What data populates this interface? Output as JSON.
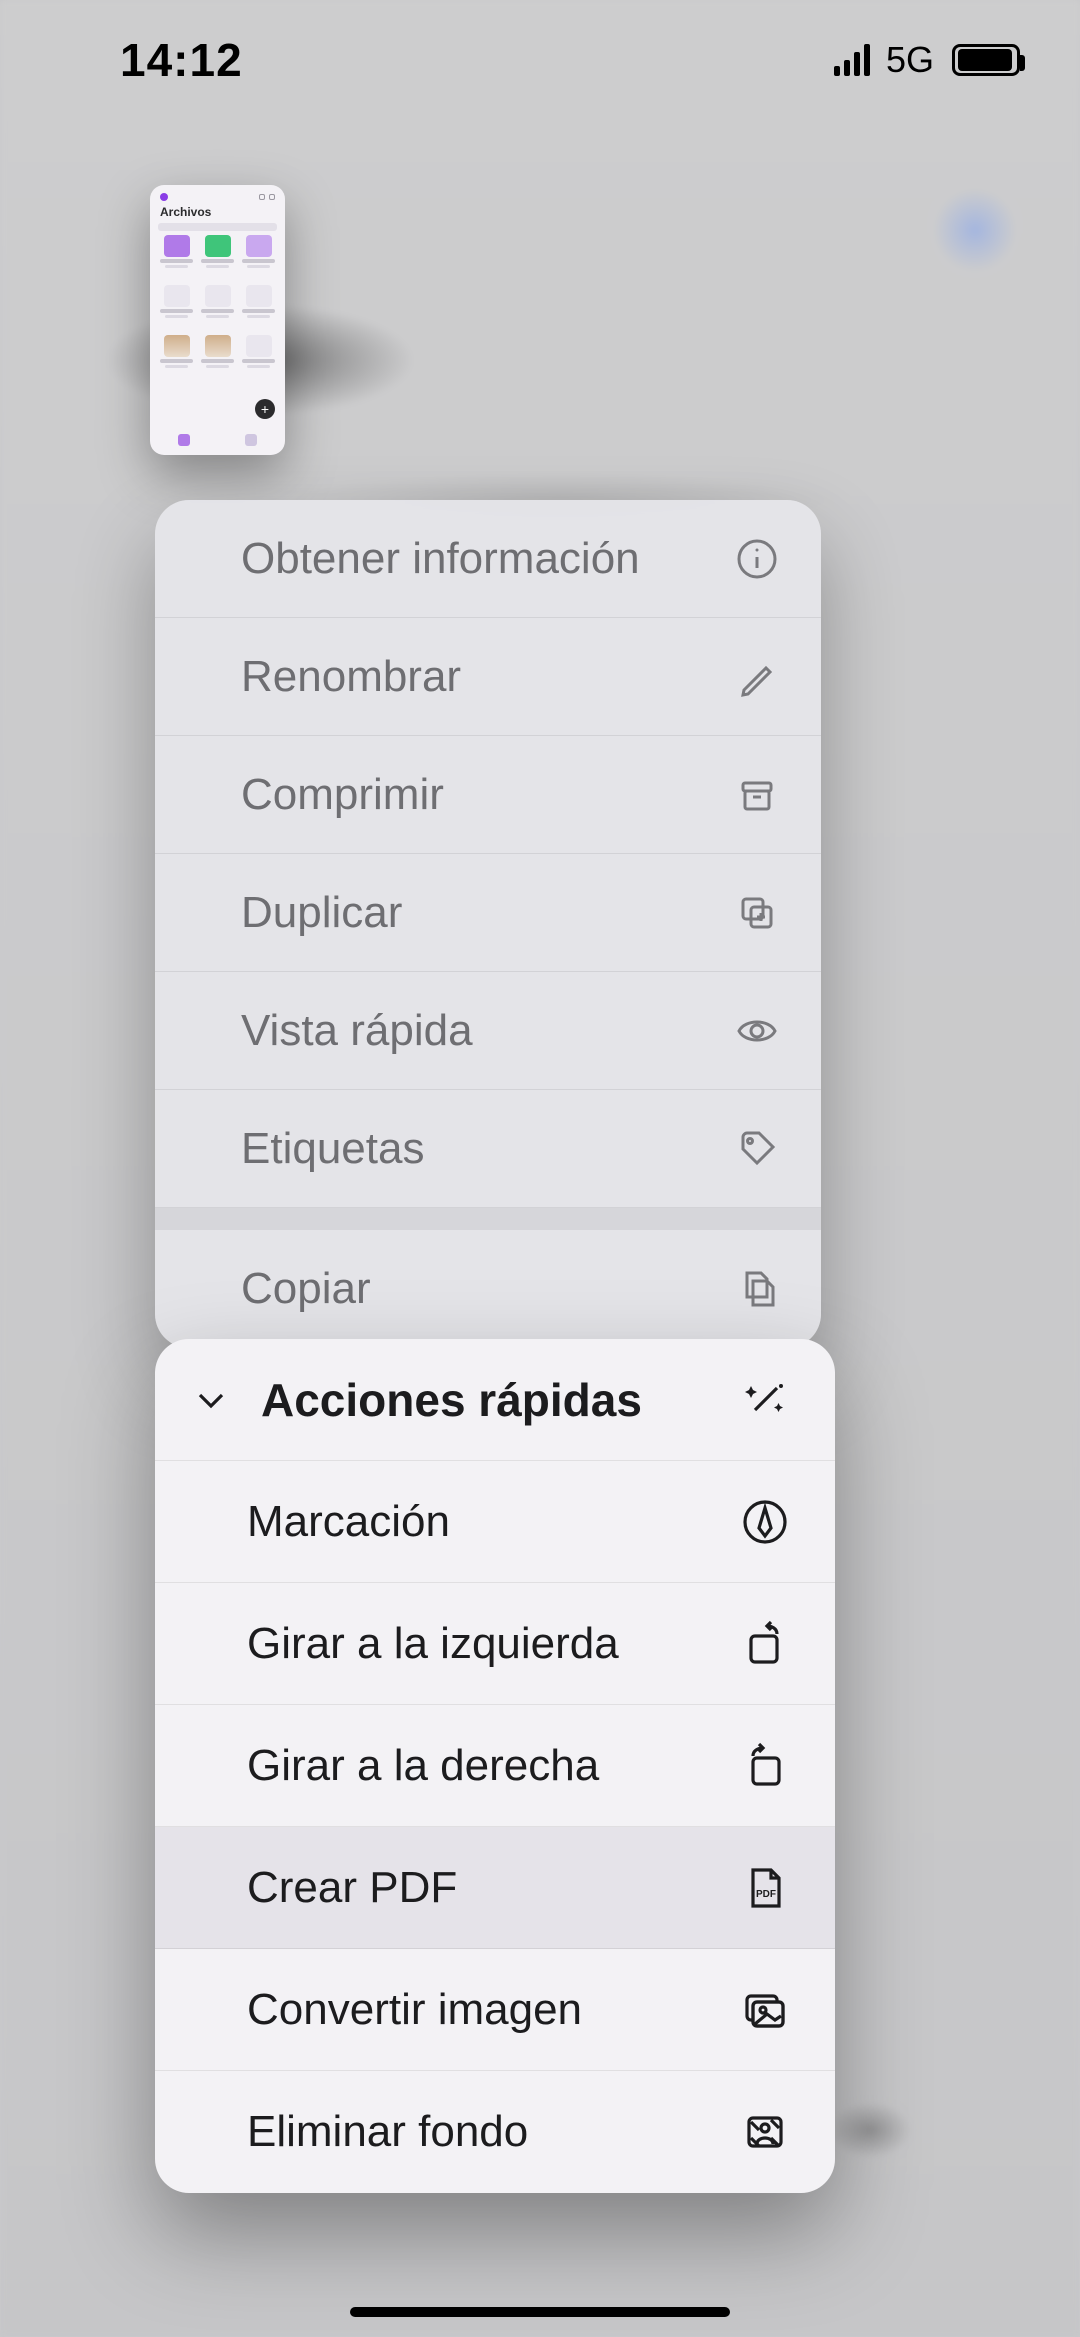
{
  "status": {
    "time": "14:12",
    "network": "5G"
  },
  "thumbnail": {
    "title": "Archivos"
  },
  "menu": {
    "info": "Obtener información",
    "rename": "Renombrar",
    "compress": "Comprimir",
    "duplicate": "Duplicar",
    "quicklook": "Vista rápida",
    "tags": "Etiquetas",
    "copy": "Copiar"
  },
  "quick": {
    "header": "Acciones rápidas",
    "markup": "Marcación",
    "rotate_left": "Girar a la izquierda",
    "rotate_right": "Girar a la derecha",
    "create_pdf": "Crear PDF",
    "convert_image": "Convertir imagen",
    "remove_bg": "Eliminar fondo"
  }
}
